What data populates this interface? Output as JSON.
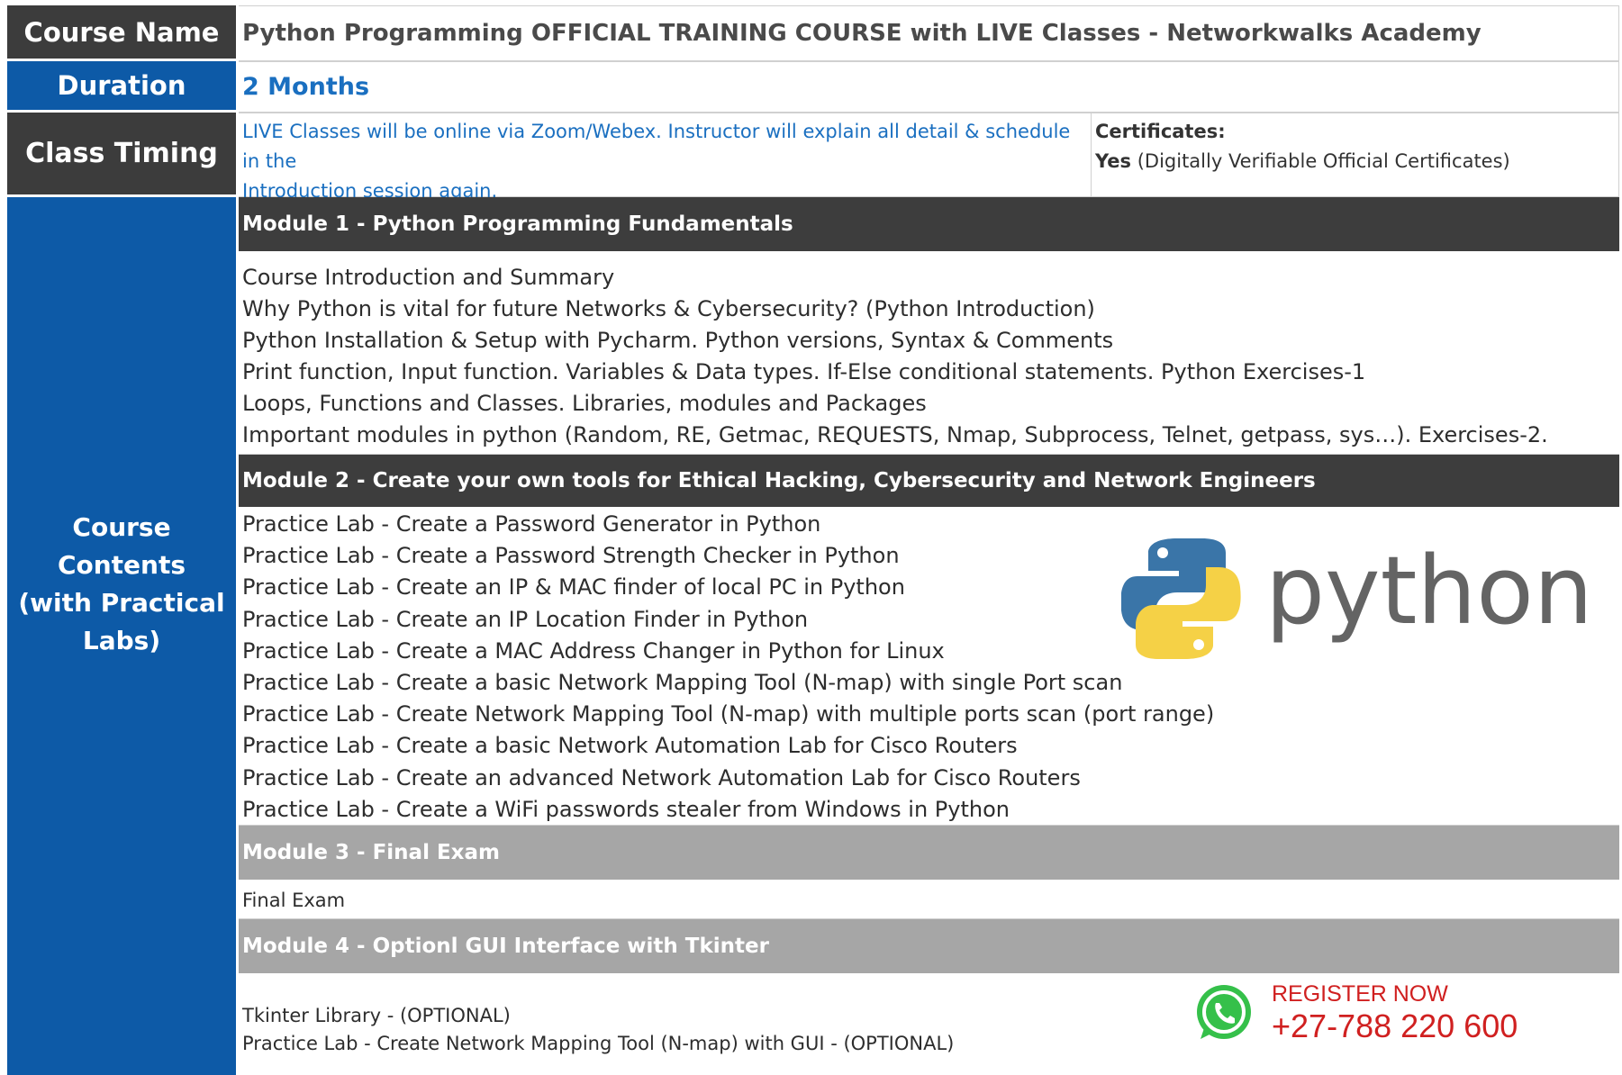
{
  "course_name": {
    "label": "Course Name",
    "value": "Python Programming OFFICIAL TRAINING COURSE with LIVE Classes - Networkwalks Academy"
  },
  "duration": {
    "label": "Duration",
    "value": "2 Months"
  },
  "class_timing": {
    "label": "Class Timing",
    "line1": "LIVE Classes will be online via Zoom/Webex. Instructor will explain all detail & schedule in the",
    "line2": "Introduction session again.",
    "cert_title": "Certificates:",
    "cert_yes": "Yes",
    "cert_detail": " (Digitally Verifiable Official Certificates)"
  },
  "course_contents": {
    "label_line1": "Course Contents",
    "label_line2": "(with Practical",
    "label_line3": "Labs)",
    "modules": [
      {
        "title": "Module 1 - Python Programming Fundamentals",
        "items": [
          "Course Introduction and Summary",
          "Why Python is vital for future Networks & Cybersecurity? (Python Introduction)",
          "Python Installation & Setup with Pycharm. Python versions, Syntax & Comments",
          "Print function, Input function. Variables & Data types. If-Else conditional statements. Python Exercises-1",
          "Loops, Functions and Classes. Libraries, modules and Packages",
          "Important modules in python (Random, RE, Getmac, REQUESTS, Nmap, Subprocess, Telnet, getpass, sys…). Exercises-2."
        ]
      },
      {
        "title": "Module 2 - Create your own tools for Ethical Hacking, Cybersecurity and Network Engineers",
        "items": [
          "Practice Lab - Create a Password Generator in Python",
          "Practice Lab - Create a Password Strength Checker in Python",
          "Practice Lab - Create an IP & MAC finder of local PC in Python",
          "Practice Lab - Create an IP Location Finder in Python",
          "Practice Lab - Create a MAC Address Changer in Python for Linux",
          "Practice Lab - Create a basic Network Mapping Tool (N-map) with single Port scan",
          "Practice Lab - Create Network Mapping Tool (N-map) with multiple ports scan (port range)",
          "Practice Lab - Create a basic Network Automation Lab for Cisco Routers",
          "Practice Lab - Create an advanced Network Automation Lab for Cisco Routers",
          "Practice Lab - Create a WiFi passwords stealer from Windows in Python"
        ]
      },
      {
        "title": "Module 3 - Final Exam",
        "items": [
          "Final Exam"
        ]
      },
      {
        "title": "Module 4 - Optionl GUI Interface with Tkinter",
        "items": [
          "Tkinter Library - (OPTIONAL)",
          "Practice Lab - Create Network Mapping Tool (N-map) with GUI - (OPTIONAL)"
        ]
      }
    ]
  },
  "python_logo": {
    "word": "python",
    "blue": "#3a75a8",
    "yellow": "#f5d146",
    "text_color": "#646464"
  },
  "register": {
    "icon": "whatsapp-icon",
    "label": "REGISTER NOW",
    "phone": "+27-788 220 600",
    "color": "#d02020"
  },
  "colors": {
    "label_dark": "#3c3c3c",
    "label_blue": "#0d5aa7",
    "module_dark": "#3d3d3d",
    "module_gray": "#a6a6a6",
    "link_blue": "#1a6fc0"
  }
}
